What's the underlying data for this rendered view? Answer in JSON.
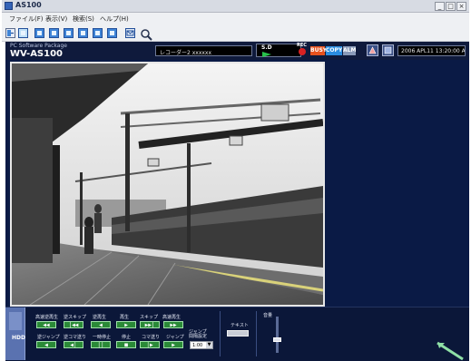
{
  "window": {
    "title": "AS100",
    "controls": [
      "_",
      "□",
      "×"
    ]
  },
  "menu": {
    "items": [
      "ファイル(F)",
      "表示(V)",
      "検索(S)",
      "ヘルプ(H)"
    ]
  },
  "toolbar": {
    "icons": [
      "exit-icon",
      "monitor-icon",
      "camera-icon",
      "layout-icon",
      "layout-icon",
      "layout-icon",
      "layout-icon",
      "layout-icon",
      "mail-icon",
      "search-icon"
    ]
  },
  "header": {
    "package_label": "PC Software Package",
    "model": "WV-AS100",
    "recorder_text": "レコーダー2  xxxxxx",
    "sd_label": "S.D",
    "rec_label": "REC",
    "badges": [
      {
        "text": "BUSY",
        "color": "#e8521e"
      },
      {
        "text": "COPY",
        "color": "#2b8de0"
      },
      {
        "text": "ALM",
        "color": "#8a9ab8"
      }
    ],
    "datetime": "2006 APL11 13:20:00 AM"
  },
  "video": {
    "description_icon": "camera-feed-icon"
  },
  "controls": {
    "hdd_label": "HDD",
    "row1": [
      {
        "label": "高速逆再生",
        "glyph": "◀◀"
      },
      {
        "label": "逆スキップ",
        "glyph": "|◀◀"
      },
      {
        "label": "逆再生",
        "glyph": "◀"
      },
      {
        "label": "再生",
        "glyph": "▶"
      },
      {
        "label": "スキップ",
        "glyph": "▶▶|"
      },
      {
        "label": "高速再生",
        "glyph": "▶▶"
      }
    ],
    "row2": [
      {
        "label": "逆ジャンプ",
        "glyph": "◀"
      },
      {
        "label": "逆コマ送り",
        "glyph": "◀|"
      },
      {
        "label": "一時停止",
        "glyph": "||"
      },
      {
        "label": "停止",
        "glyph": "■"
      },
      {
        "label": "コマ送り",
        "glyph": "|▶"
      },
      {
        "label": "ジャンプ",
        "glyph": "▶"
      }
    ],
    "jump_label": "ジャンプ\n間隔設定",
    "jump_value": "1:00",
    "text_label": "テキスト",
    "volume_label": "音量",
    "volume_level": 0.35
  },
  "colors": {
    "header_bg": "#0f1a3c",
    "panel_bg": "#0b1739",
    "video_area_bg": "#0a1a45",
    "accent_green": "#2a8a37"
  }
}
